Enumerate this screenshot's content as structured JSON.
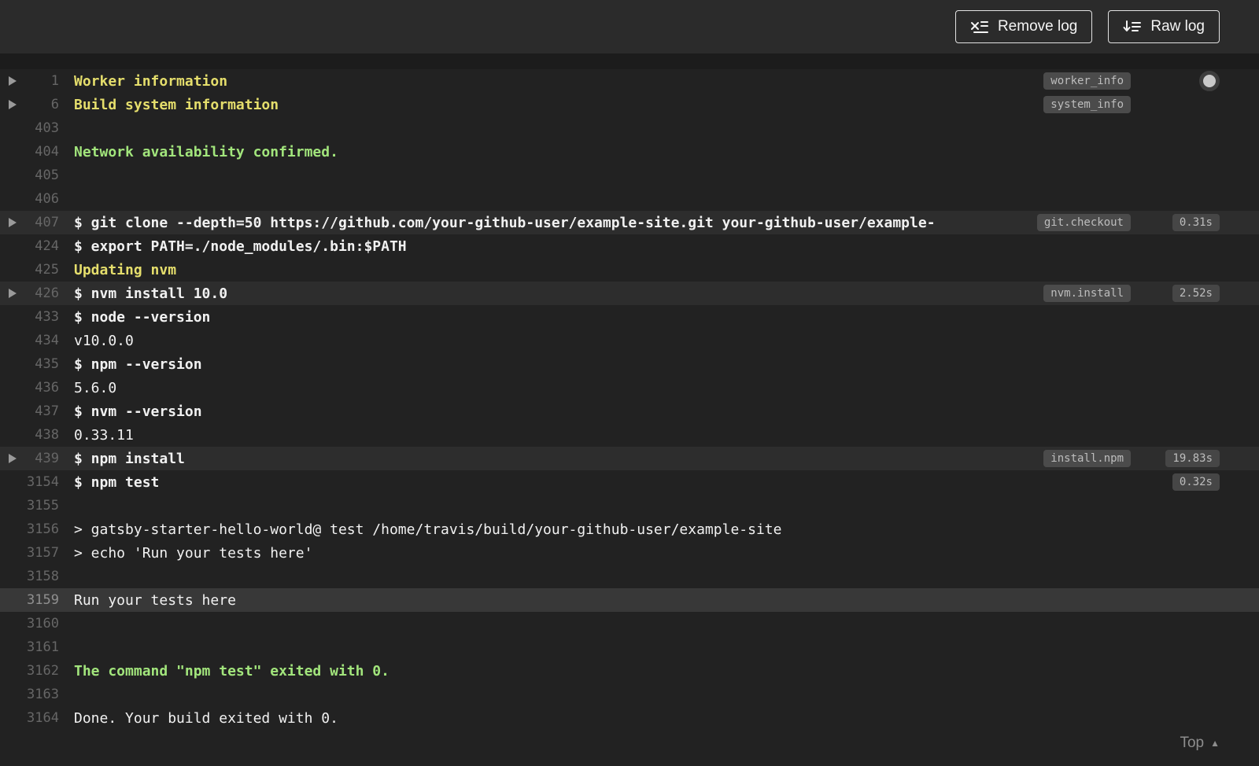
{
  "toolbar": {
    "remove_log_label": "Remove log",
    "raw_log_label": "Raw log"
  },
  "log": {
    "top_link": "Top",
    "lines": [
      {
        "number": "1",
        "text": "Worker information",
        "style": "section",
        "fold": true,
        "badge": "worker_info",
        "indicator": true
      },
      {
        "number": "6",
        "text": "Build system information",
        "style": "section",
        "fold": true,
        "badge": "system_info"
      },
      {
        "number": "403",
        "text": ""
      },
      {
        "number": "404",
        "text": "Network availability confirmed.",
        "style": "success"
      },
      {
        "number": "405",
        "text": ""
      },
      {
        "number": "406",
        "text": ""
      },
      {
        "number": "407",
        "text": "$ git clone --depth=50 https://github.com/your-github-user/example-site.git your-github-user/example-",
        "style": "command",
        "fold": true,
        "highlight": true,
        "badge": "git.checkout",
        "time": "0.31s"
      },
      {
        "number": "424",
        "text": "$ export PATH=./node_modules/.bin:$PATH",
        "style": "command"
      },
      {
        "number": "425",
        "text": "Updating nvm",
        "style": "section"
      },
      {
        "number": "426",
        "text": "$ nvm install 10.0",
        "style": "command",
        "fold": true,
        "highlight": true,
        "badge": "nvm.install",
        "time": "2.52s"
      },
      {
        "number": "433",
        "text": "$ node --version",
        "style": "command"
      },
      {
        "number": "434",
        "text": "v10.0.0"
      },
      {
        "number": "435",
        "text": "$ npm --version",
        "style": "command"
      },
      {
        "number": "436",
        "text": "5.6.0"
      },
      {
        "number": "437",
        "text": "$ nvm --version",
        "style": "command"
      },
      {
        "number": "438",
        "text": "0.33.11"
      },
      {
        "number": "439",
        "text": "$ npm install",
        "style": "command",
        "fold": true,
        "highlight": true,
        "badge": "install.npm",
        "time": "19.83s"
      },
      {
        "number": "3154",
        "text": "$ npm test",
        "style": "command",
        "time": "0.32s"
      },
      {
        "number": "3155",
        "text": ""
      },
      {
        "number": "3156",
        "text": "> gatsby-starter-hello-world@ test /home/travis/build/your-github-user/example-site"
      },
      {
        "number": "3157",
        "text": "> echo 'Run your tests here'"
      },
      {
        "number": "3158",
        "text": ""
      },
      {
        "number": "3159",
        "text": "Run your tests here",
        "selected": true
      },
      {
        "number": "3160",
        "text": ""
      },
      {
        "number": "3161",
        "text": ""
      },
      {
        "number": "3162",
        "text": "The command \"npm test\" exited with 0.",
        "style": "success"
      },
      {
        "number": "3163",
        "text": ""
      },
      {
        "number": "3164",
        "text": "Done. Your build exited with 0."
      }
    ]
  },
  "colors": {
    "toolbar_bg": "#2b2b2b",
    "log_bg": "#222222",
    "page_bg": "#1c1c1c",
    "section_text": "#e5de6c",
    "success_text": "#a2e57c",
    "default_text": "#f1f1f1",
    "line_number": "#666666",
    "badge_bg": "#4b4b4b",
    "badge_text": "#bdbdbd",
    "fold_row_bg": "#2d2d2d",
    "selected_row_bg": "#383838"
  }
}
